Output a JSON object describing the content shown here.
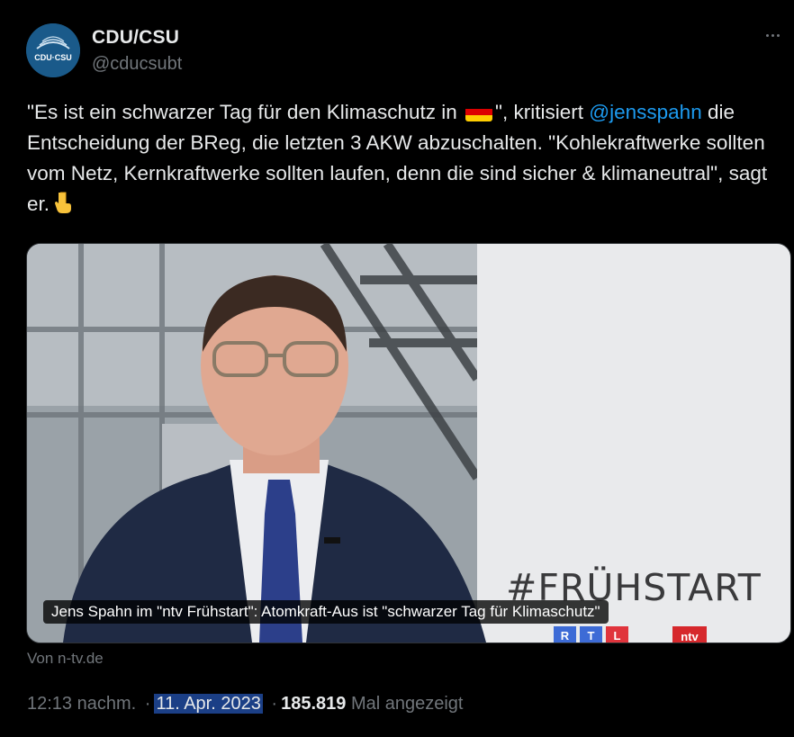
{
  "tweet": {
    "display_name": "CDU/CSU",
    "handle": "@cducsubt",
    "avatar_text": "CDU·CSU",
    "text_part1": "\"Es ist ein schwarzer Tag für den Klimaschutz in ",
    "flag_icon": "german-flag-emoji",
    "text_part2": "\", kritisiert ",
    "mention": "@jensspahn",
    "text_part3": " die Entscheidung der BReg, die letzten 3 AKW abzuschalten. \"Kohlekraftwerke sollten vom Netz, Kernkraftwerke sollten laufen, denn die sind sicher & klimaneutral\", sagt er.",
    "emoji_icon": "pointing-down-hand-emoji"
  },
  "media": {
    "studio_title": "#FRÜHSTART",
    "logo_rtl": [
      "R",
      "T",
      "L"
    ],
    "logo_rtl_colors": [
      "#3d6bd6",
      "#3d6bd6",
      "#e0343c"
    ],
    "logo_ntv": "ntv",
    "caption": "Jens Spahn im \"ntv Frühstart\": Atomkraft-Aus ist \"schwarzer Tag für Klimaschutz\"",
    "source": "Von n-tv.de"
  },
  "meta": {
    "time": "12:13 nachm.",
    "separator": "·",
    "date": "11. Apr. 2023",
    "views": "185.819",
    "views_label": "Mal angezeigt"
  },
  "colors": {
    "background": "#000000",
    "text": "#e7e9ea",
    "secondary": "#71767b",
    "link": "#1d9bf0",
    "date_highlight": "#1b3f86"
  }
}
